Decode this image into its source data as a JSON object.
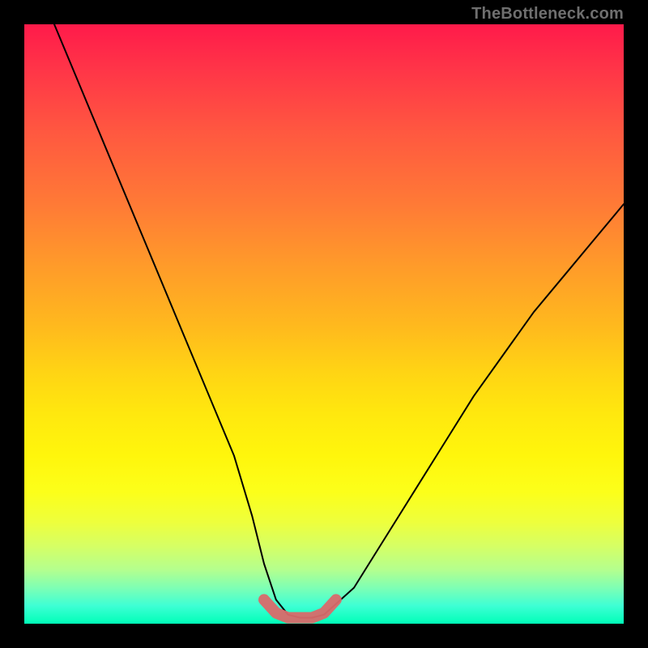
{
  "watermark": "TheBottleneck.com",
  "chart_data": {
    "type": "line",
    "title": "",
    "xlabel": "",
    "ylabel": "",
    "xlim": [
      0,
      100
    ],
    "ylim": [
      0,
      100
    ],
    "grid": false,
    "series": [
      {
        "name": "curve",
        "x": [
          5,
          10,
          15,
          20,
          25,
          30,
          35,
          38,
          40,
          42,
          44,
          46,
          48,
          50,
          55,
          60,
          65,
          70,
          75,
          80,
          85,
          90,
          95,
          100
        ],
        "values": [
          100,
          88,
          76,
          64,
          52,
          40,
          28,
          18,
          10,
          4,
          1.5,
          1,
          1,
          1.5,
          6,
          14,
          22,
          30,
          38,
          45,
          52,
          58,
          64,
          70
        ]
      },
      {
        "name": "highlight-band",
        "x": [
          40,
          42,
          44,
          46,
          48,
          50,
          52
        ],
        "values": [
          4,
          1.8,
          1,
          1,
          1,
          1.8,
          4
        ]
      }
    ],
    "colors": {
      "curve": "#000000",
      "highlight": "#d96a6a"
    }
  }
}
